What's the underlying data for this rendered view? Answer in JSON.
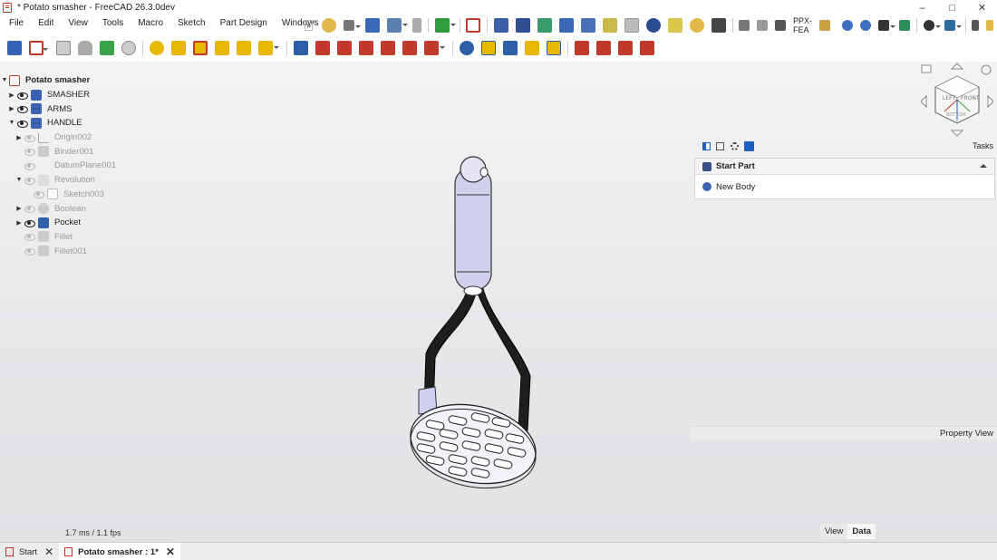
{
  "window": {
    "title": "* Potato smasher - FreeCAD 26.3.0dev",
    "minimize": "–",
    "maximize": "□",
    "close": "✕"
  },
  "menu": [
    "File",
    "Edit",
    "View",
    "Tools",
    "Macro",
    "Sketch",
    "Part Design",
    "Windows"
  ],
  "toolbar": {
    "overflow": "»",
    "workbench_label": "PPX-FEA"
  },
  "tree": {
    "root": "Potato smasher",
    "items": [
      {
        "label": "SMASHER",
        "expand": "▶",
        "visible": true
      },
      {
        "label": "ARMS",
        "expand": "▶",
        "visible": true
      },
      {
        "label": "HANDLE",
        "expand": "▼",
        "visible": true
      },
      {
        "label": "Origin002",
        "expand": "▶",
        "visible": false
      },
      {
        "label": "Binder001",
        "expand": "",
        "visible": false
      },
      {
        "label": "DatumPlane001",
        "expand": "",
        "visible": false
      },
      {
        "label": "Revolution",
        "expand": "▼",
        "visible": false
      },
      {
        "label": "Sketch003",
        "expand": "",
        "visible": false
      },
      {
        "label": "Boolean",
        "expand": "▶",
        "visible": false
      },
      {
        "label": "Pocket",
        "expand": "▶",
        "visible": true
      },
      {
        "label": "Fillet",
        "expand": "",
        "visible": false
      },
      {
        "label": "Fillet001",
        "expand": "",
        "visible": false
      }
    ]
  },
  "status": {
    "fps": "1.7 ms / 1.1 fps"
  },
  "navcube": {
    "left": "LEFT",
    "front": "FRONT",
    "bottom": "BOTTOM"
  },
  "tasks": {
    "label": "Tasks",
    "section_title": "Start Part",
    "action": "New Body"
  },
  "property_view": {
    "label": "Property View"
  },
  "view_tabs": [
    "View",
    "Data"
  ],
  "doc_tabs": [
    {
      "label": "Start"
    },
    {
      "label": "Potato smasher : 1*"
    }
  ],
  "colors": {
    "accent_blue": "#1f5fbf",
    "part_red": "#c0392b",
    "part_yellow": "#e6b800",
    "handle_grip": "#c8c8e8"
  }
}
